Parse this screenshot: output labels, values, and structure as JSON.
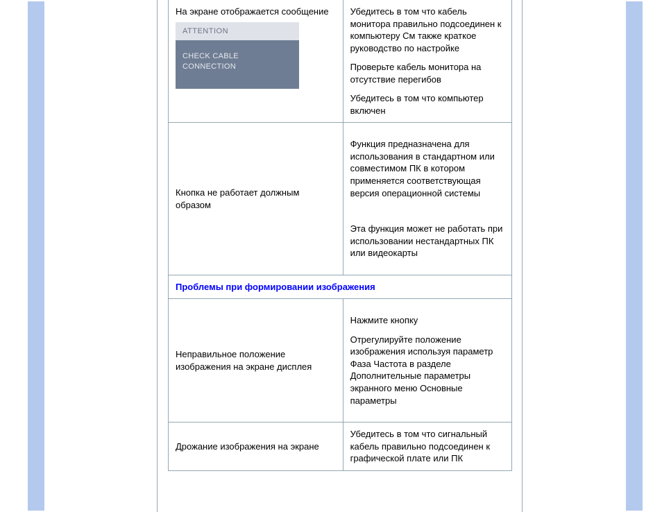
{
  "rows": [
    {
      "left_intro": "На экране отображается сообщение",
      "msg_title": "ATTENTION",
      "msg_body": "CHECK CABLE CONNECTION",
      "right_paras": [
        "Убедитесь в том  что кабель монитора правильно подсоединен к компьютеру   См  также краткое руководство по настройке",
        "Проверьте кабель монитора на отсутствие перегибов",
        "Убедитесь в том  что компьютер включен"
      ]
    },
    {
      "left_text": "Кнопка          не работает должным образом",
      "right_paras": [
        "Функция         предназначена для использования в стандартном                     или         совместимом ПК  в котором применяется соответствующая версия операционной системы",
        "Эта функция может не работать при использовании нестандартных ПК или видеокарты"
      ]
    }
  ],
  "section_header": "Проблемы при формировании изображения",
  "rows2": [
    {
      "left_text": "Неправильное положение изображения на экране дисплея",
      "right_paras": [
        "Нажмите кнопку",
        "Отрегулируйте положение изображения  используя параметр                   Фаза Частота  в разделе                    Дополнительные параметры  экранного меню Основные параметры"
      ]
    },
    {
      "left_text": "Дрожание изображения на экране",
      "right_paras": [
        "Убедитесь в том  что сигнальный кабель правильно подсоединен к графической плате или ПК"
      ]
    }
  ]
}
